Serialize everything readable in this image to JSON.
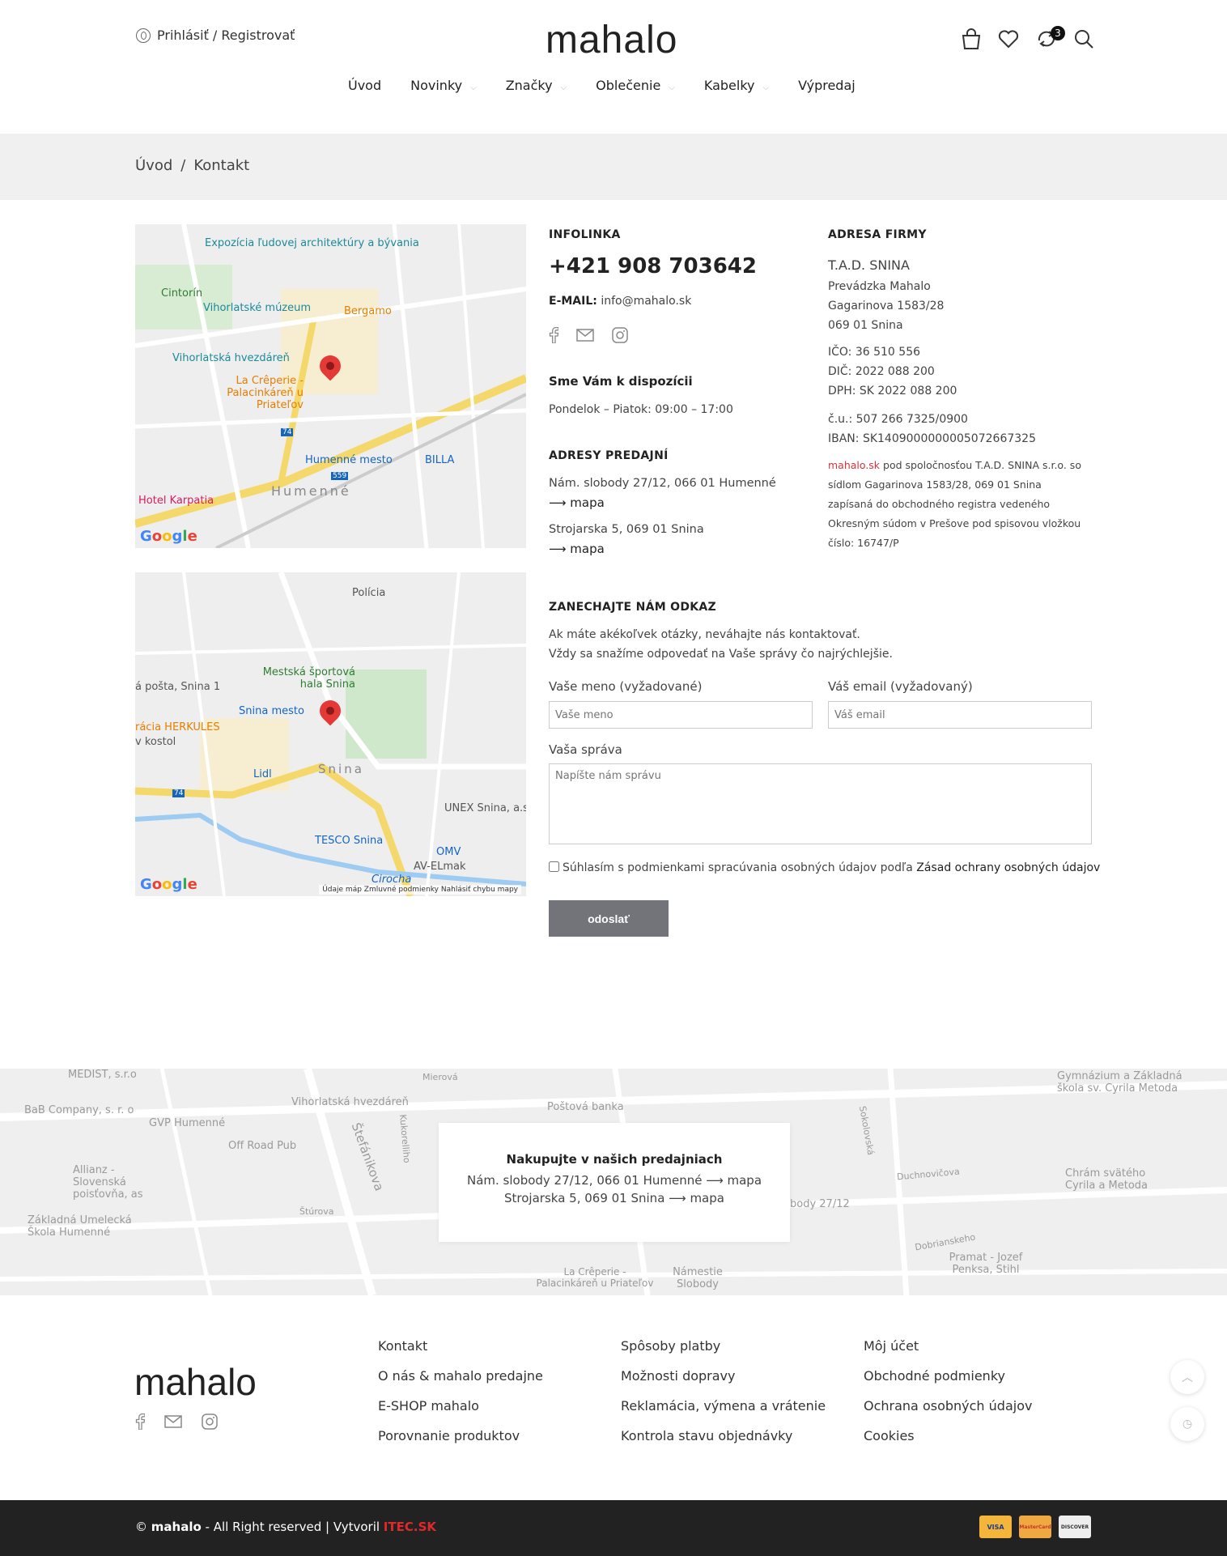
{
  "header": {
    "login_label": "Prihlásiť / Registrovať",
    "logo": "mahalo",
    "compare_count": "3"
  },
  "nav": {
    "items": [
      {
        "label": "Úvod"
      },
      {
        "label": "Novinky"
      },
      {
        "label": "Značky"
      },
      {
        "label": "Oblečenie"
      },
      {
        "label": "Kabelky"
      },
      {
        "label": "Výpredaj"
      }
    ]
  },
  "breadcrumb": {
    "home": "Úvod",
    "sep": "/",
    "current": "Kontakt"
  },
  "map1": {
    "labels": [
      "Expozícia ľudovej architektúry a bývania",
      "Cintorín",
      "Vihorlatské múzeum",
      "Bergamo",
      "Vihorlatská hvezdáreň",
      "La Crêperie - Palacinkáreň u Priateľov",
      "Humenné mesto",
      "BILLA",
      "Humenné",
      "Hotel Karpatia",
      "74",
      "559"
    ],
    "google": "Google"
  },
  "map2": {
    "labels": [
      "Polícia",
      "Mestská športová hala Snina",
      "á pošta, Snina 1",
      "Snina mesto",
      "rácia HERKULES",
      "v kostol",
      "Lidl",
      "Snina",
      "UNEX Snina, a.s.",
      "TESCO Snina",
      "OMV",
      "AV-ELmak",
      "Cirocha",
      "74"
    ],
    "google": "Google",
    "footer": "Údaje máp   Zmluvné podmienky   Nahlásiť chybu mapy"
  },
  "infolinka": {
    "heading": "INFOLINKA",
    "phone": "+421 908 703642",
    "email_label": "E-MAIL:",
    "email": "info@mahalo.sk",
    "available_heading": "Sme Vám k dispozícii",
    "hours": "Pondelok – Piatok: 09:00 – 17:00",
    "stores_heading": "ADRESY PREDAJNÍ",
    "store1": "Nám. slobody 27/12, 066 01 Humenné",
    "store2": "Strojarska 5, 069 01 Snina",
    "map_link": "⟶ mapa"
  },
  "company": {
    "heading": "ADRESA FIRMY",
    "name": "T.A.D. SNINA",
    "line1": "Prevádzka Mahalo",
    "line2": "Gagarinova 1583/28",
    "line3": "069 01 Snina",
    "ico": "IČO: 36 510 556",
    "dic": "DIČ: 2022 088 200",
    "dph": "DPH: SK 2022 088 200",
    "cu": "č.u.: 507 266 7325/0900",
    "iban": "IBAN: SK1409000000005072667325",
    "legal_brand": "mahalo.sk",
    "legal_1": " pod spoločnosťou T.A.D. SNINA s.r.o. so",
    "legal_2": "sídlom Gagarinova 1583/28, 069 01 Snina",
    "legal_3": "zapísaná do obchodného registra vedeného",
    "legal_4": "Okresným súdom v Prešove pod spisovou vložkou",
    "legal_5": "číslo: 16747/P"
  },
  "form": {
    "heading": "ZANECHAJTE NÁM ODKAZ",
    "intro1": "Ak máte akékoľvek otázky, neváhajte nás kontaktovať.",
    "intro2": "Vždy sa snažíme odpovedať na Vaše správy čo najrýchlejšie.",
    "name_label": "Vaše meno (vyžadované)",
    "name_placeholder": "Vaše meno",
    "email_label": "Váš email (vyžadovaný)",
    "email_placeholder": "Váš email",
    "message_label": "Vaša správa",
    "message_placeholder": "Napíšte nám správu",
    "consent_text": "Súhlasím s podmienkami spracúvania osobných údajov podľa ",
    "consent_link": "Zásad ochrany osobných údajov",
    "submit": "odoslať"
  },
  "band": {
    "title": "Nakupujte v našich predajniach",
    "line1": "Nám. slobody 27/12, 066 01 Humenné",
    "line2": "Strojarska 5, 069 01 Snina",
    "map_link": "⟶ mapa",
    "map_labels": [
      "MEDIST, s.r.o",
      "BaB Company, s. r. o",
      "GVP Humenné",
      "Off Road Pub",
      "Allianz - Slovenská poisťovňa, as",
      "Základná Umelecká Škola Humenné",
      "Vihorlatská hvezdáreň",
      "Poštová banka",
      "Gymnázium a Základná škola sv. Cyrila Metoda",
      "Chrám svätého Cyrila a Metoda",
      "Pramat - Jozef Penksa, Stihl",
      "La Crêperie - Palacinkáreň u Priateľov",
      "Námestie Slobody",
      "Štefánikova",
      "Kukorelliho",
      "Sokolovská",
      "Duchnovičova",
      "Dobrianskeho",
      "Štúrova",
      "Mierová",
      "body 27/12"
    ]
  },
  "footer": {
    "logo": "mahalo",
    "col1": [
      "Kontakt",
      "O nás & mahalo predajne",
      "E-SHOP mahalo",
      "Porovnanie produktov"
    ],
    "col2": [
      "Spôsoby platby",
      "Možnosti dopravy",
      "Reklamácia, výmena a vrátenie",
      "Kontrola stavu objednávky"
    ],
    "col3": [
      "Môj účet",
      "Obchodné podmienky",
      "Ochrana osobných údajov",
      "Cookies"
    ],
    "copy_prefix": "© ",
    "copy_brand": "mahalo",
    "copy_mid": " - All Right reserved | Vytvoril ",
    "copy_author": "ITEC.SK",
    "payment_cards": [
      "VISA",
      "MasterCard",
      "DISCOVER"
    ]
  },
  "colors": {
    "accent": "#d6323a",
    "button": "#727479",
    "footer_bar": "#222222"
  }
}
